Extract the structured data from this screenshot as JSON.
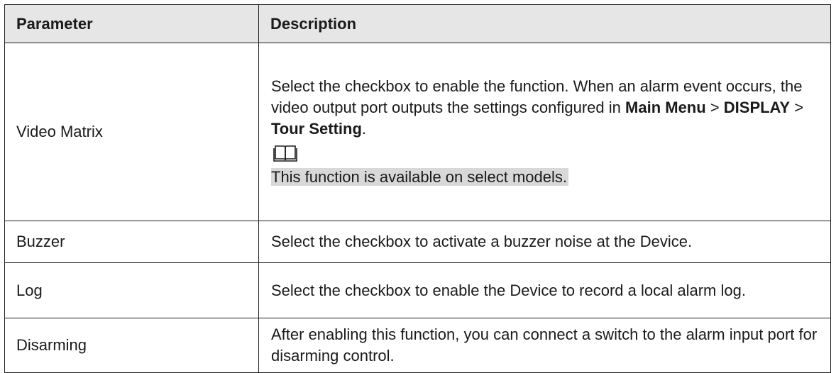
{
  "table": {
    "headers": {
      "parameter": "Parameter",
      "description": "Description"
    },
    "rows": [
      {
        "name": "Video Matrix",
        "description": "Select the checkbox to enable the function. When an alarm event occurs, the video output port outputs the settings configured in",
        "menu_path": {
          "part1": "Main Menu",
          "sep1": " > ",
          "part2": "DISPLAY",
          "sep2": " > ",
          "part3": "Tour Setting",
          "end": "."
        },
        "note_icon": "book-icon",
        "note": "This function is available on select models."
      },
      {
        "name": "Buzzer",
        "description": "Select the checkbox to activate a buzzer noise at the Device."
      },
      {
        "name": "Log",
        "description": "Select the checkbox to enable the Device to record a local alarm log."
      },
      {
        "name": "Disarming",
        "description": "After enabling this function, you can connect a switch to the alarm input port for disarming control."
      }
    ]
  },
  "colors": {
    "header_bg": "#e6e6e6",
    "border": "#1f1f1f",
    "note_highlight": "#d8d8d8"
  }
}
